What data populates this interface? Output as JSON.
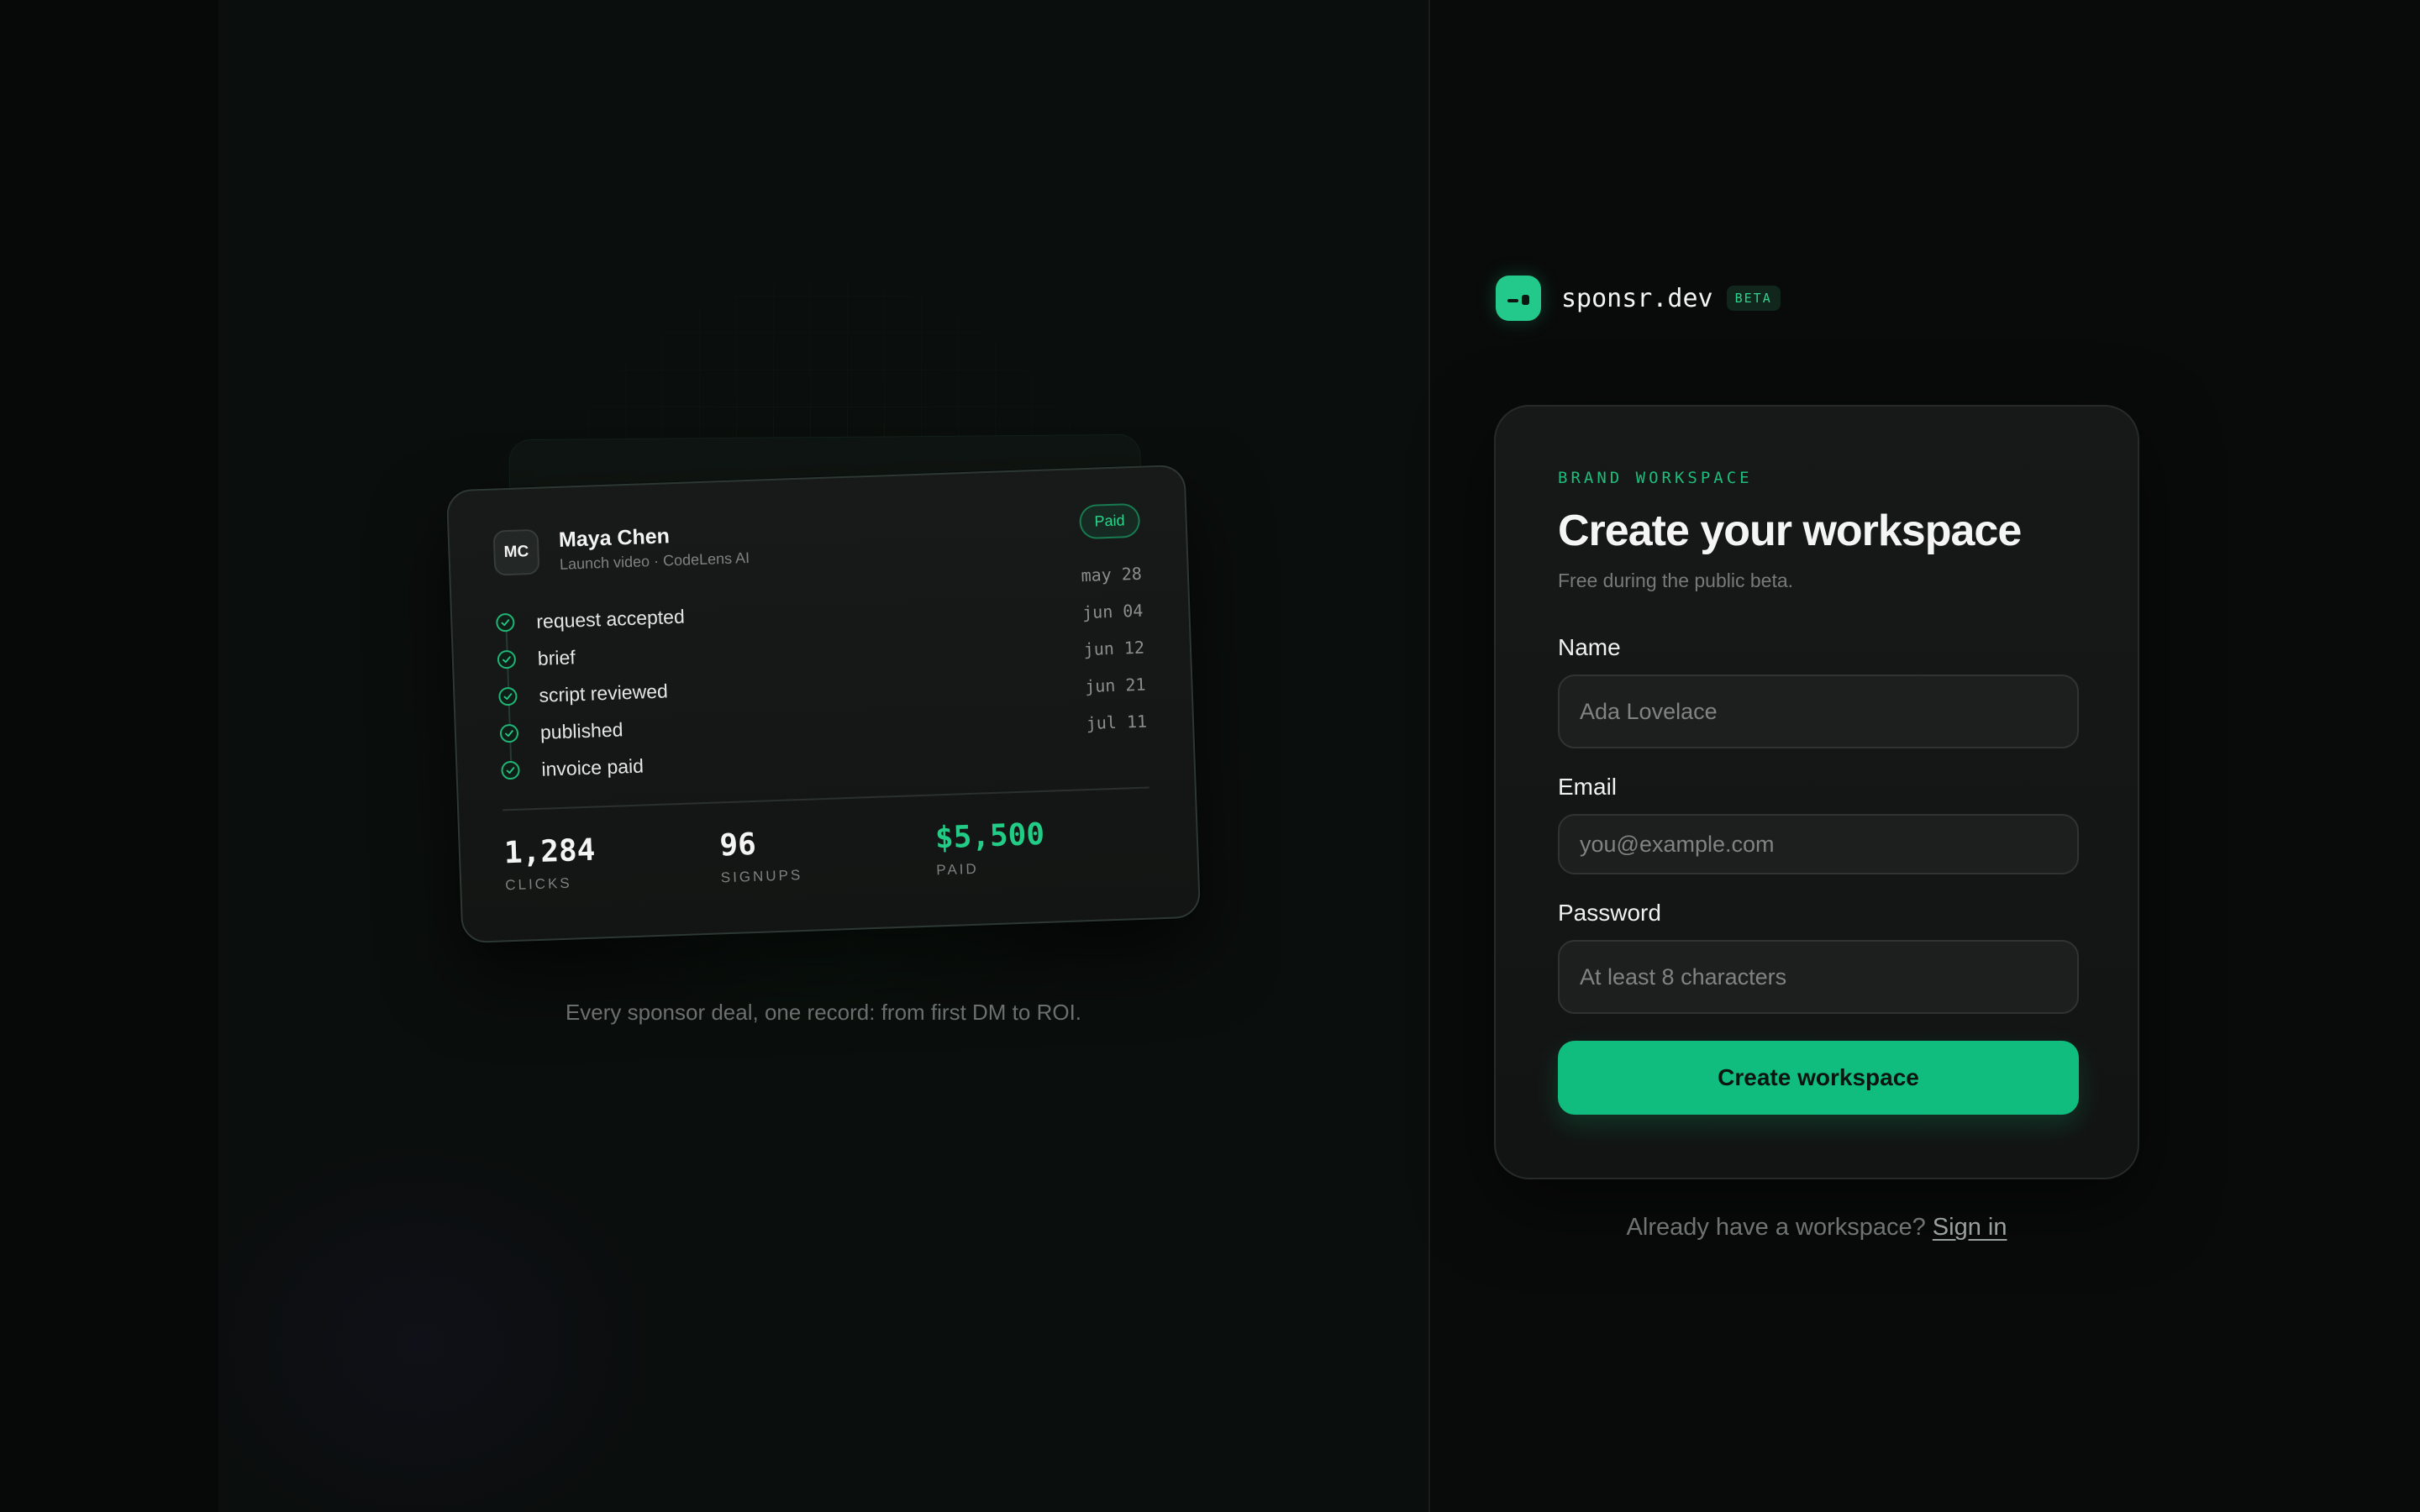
{
  "hero": {
    "card": {
      "avatar_initials": "MC",
      "name": "Maya Chen",
      "subtitle": "Launch video · CodeLens AI",
      "status_badge": "Paid",
      "timeline": [
        {
          "label": "request accepted",
          "date": "may 28"
        },
        {
          "label": "brief",
          "date": "jun 04"
        },
        {
          "label": "script reviewed",
          "date": "jun 12"
        },
        {
          "label": "published",
          "date": "jun 21"
        },
        {
          "label": "invoice paid",
          "date": "jul 11"
        }
      ],
      "stats": [
        {
          "value": "1,284",
          "label": "CLICKS"
        },
        {
          "value": "96",
          "label": "SIGNUPS"
        },
        {
          "value": "$5,500",
          "label": "PAID"
        }
      ]
    },
    "caption": "Every sponsor deal, one record: from first DM to ROI."
  },
  "brand": {
    "name": "sponsr.dev",
    "badge": "BETA",
    "logo_icon": "brand-logo-icon",
    "accent_color": "#10bd7e"
  },
  "form": {
    "eyebrow": "BRAND WORKSPACE",
    "title": "Create your workspace",
    "subtitle": "Free during the public beta.",
    "name_label": "Name",
    "name_placeholder": "Ada Lovelace",
    "email_label": "Email",
    "email_placeholder": "you@example.com",
    "password_label": "Password",
    "password_placeholder": "At least 8 characters",
    "submit_label": "Create workspace"
  },
  "footer": {
    "prompt": "Already have a workspace?",
    "signin_label": "Sign in"
  }
}
